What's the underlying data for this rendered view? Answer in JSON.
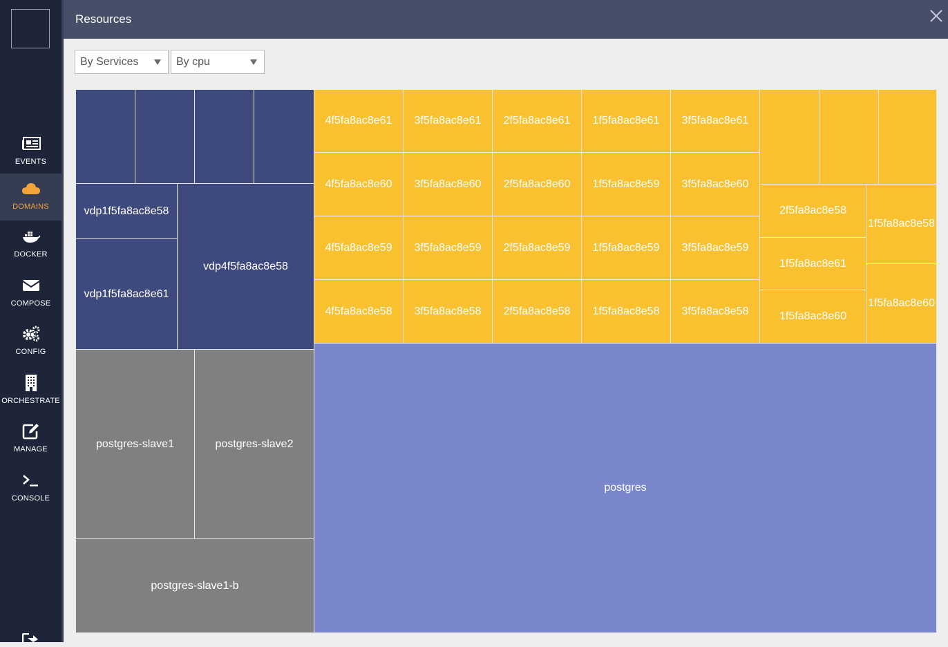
{
  "header": {
    "title": "Resources"
  },
  "filters": {
    "group_by": "By Services",
    "metric": "By cpu"
  },
  "sidebar": {
    "items": [
      {
        "label": "EVENTS",
        "icon": "newspaper-icon",
        "active": false
      },
      {
        "label": "DOMAINS",
        "icon": "cloud-icon",
        "active": true
      },
      {
        "label": "DOCKER",
        "icon": "docker-whale-icon",
        "active": false
      },
      {
        "label": "COMPOSE",
        "icon": "envelope-icon",
        "active": false
      },
      {
        "label": "CONFIG",
        "icon": "gears-icon",
        "active": false
      },
      {
        "label": "ORCHESTRATE",
        "icon": "building-icon",
        "active": false
      },
      {
        "label": "MANAGE",
        "icon": "edit-icon",
        "active": false
      },
      {
        "label": "CONSOLE",
        "icon": "terminal-icon",
        "active": false
      }
    ]
  },
  "colors": {
    "navy": "#3e4a7d",
    "yellow": "#f9c02f",
    "gray": "#808080",
    "lavender": "#7986cb",
    "active_nav": "#f3a33a"
  },
  "treemap": {
    "navy_small": [
      "",
      "",
      "",
      ""
    ],
    "navy_labels": [
      "vdp1f5fa8ac8e58",
      "vdp1f5fa8ac8e61",
      "vdp4f5fa8ac8e58"
    ],
    "yellow_grid": [
      [
        "4f5fa8ac8e61",
        "3f5fa8ac8e61",
        "2f5fa8ac8e61",
        "1f5fa8ac8e61",
        "3f5fa8ac8e61"
      ],
      [
        "4f5fa8ac8e60",
        "3f5fa8ac8e60",
        "2f5fa8ac8e60",
        "1f5fa8ac8e59",
        "3f5fa8ac8e60"
      ],
      [
        "4f5fa8ac8e59",
        "3f5fa8ac8e59",
        "2f5fa8ac8e59",
        "1f5fa8ac8e59",
        "3f5fa8ac8e59"
      ],
      [
        "4f5fa8ac8e58",
        "3f5fa8ac8e58",
        "2f5fa8ac8e58",
        "1f5fa8ac8e58",
        "3f5fa8ac8e58"
      ]
    ],
    "yellow_right_top": [
      "",
      "",
      ""
    ],
    "yellow_right_col": [
      "2f5fa8ac8e58",
      "1f5fa8ac8e61",
      "1f5fa8ac8e60"
    ],
    "yellow_far_right": [
      "1f5fa8ac8e58",
      "1f5fa8ac8e60"
    ],
    "gray_labels": [
      "postgres-slave1",
      "postgres-slave2",
      "postgres-slave1-b"
    ],
    "main_label": "postgres"
  }
}
